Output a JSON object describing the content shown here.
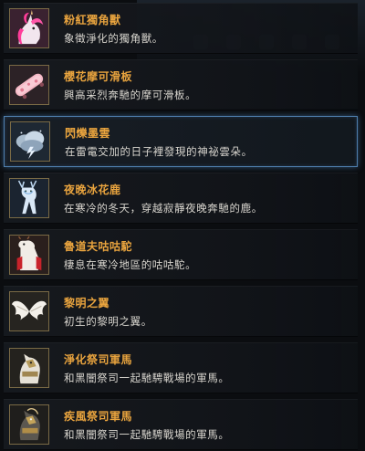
{
  "items": [
    {
      "name": "粉紅獨角獸",
      "desc": "象徵淨化的獨角獸。",
      "icon": "pink-unicorn-icon",
      "selected": false
    },
    {
      "name": "櫻花摩可滑板",
      "desc": "興高采烈奔馳的摩可滑板。",
      "icon": "sakura-skateboard-icon",
      "selected": false
    },
    {
      "name": "閃爍墨雲",
      "desc": "在雷電交加的日子裡發現的神祕雲朵。",
      "icon": "thunder-cloud-icon",
      "selected": true
    },
    {
      "name": "夜晚冰花鹿",
      "desc": "在寒冷的冬天，穿越寂靜夜晚奔馳的鹿。",
      "icon": "ice-deer-icon",
      "selected": false
    },
    {
      "name": "魯道夫咕咕駝",
      "desc": "棲息在寒冷地區的咕咕駝。",
      "icon": "rudolph-camel-icon",
      "selected": false
    },
    {
      "name": "黎明之翼",
      "desc": "初生的黎明之翼。",
      "icon": "dawn-wings-icon",
      "selected": false
    },
    {
      "name": "淨化祭司軍馬",
      "desc": "和黑闇祭司一起馳騁戰場的軍馬。",
      "icon": "purified-warhorse-icon",
      "selected": false
    },
    {
      "name": "疾風祭司軍馬",
      "desc": "和黑闇祭司一起馳騁戰場的軍馬。",
      "icon": "gale-warhorse-icon",
      "selected": false
    }
  ],
  "colors": {
    "name": "#e9a43e",
    "desc": "#d9d6cf",
    "selected_border": "#4f7fae",
    "icon_frame": "#7a6a45"
  }
}
